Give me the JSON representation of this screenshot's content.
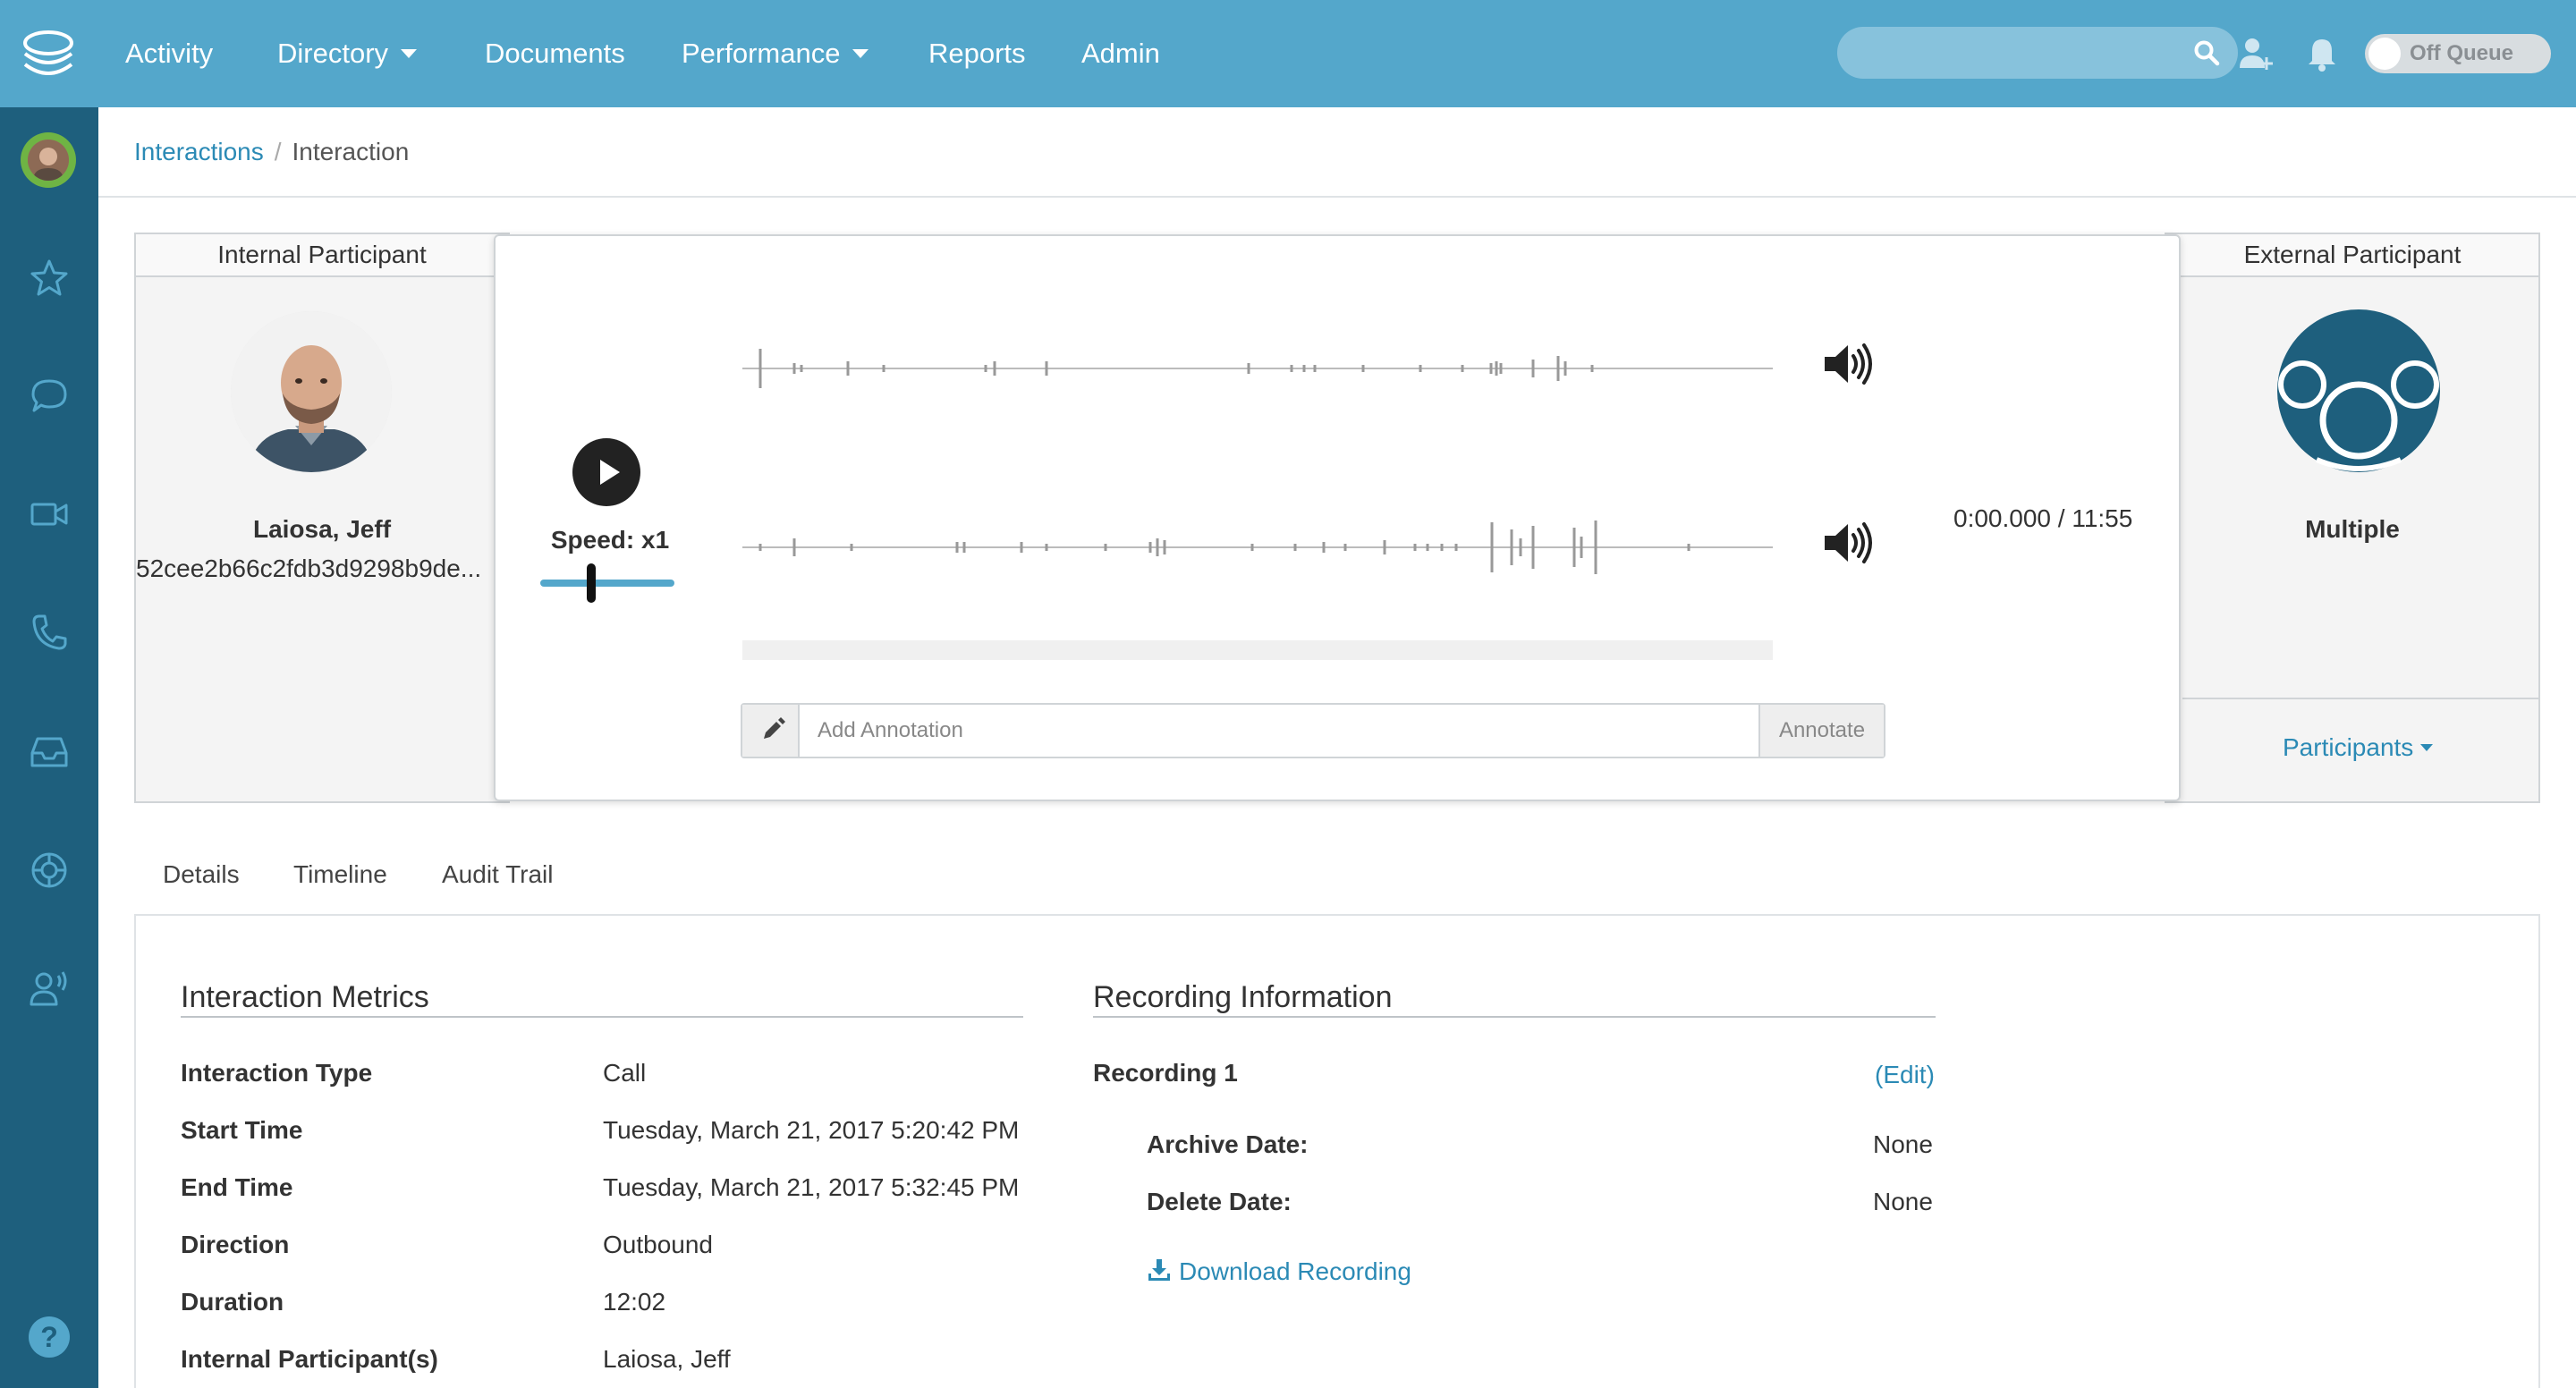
{
  "nav": {
    "items": [
      {
        "label": "Activity",
        "dropdown": false
      },
      {
        "label": "Directory",
        "dropdown": true
      },
      {
        "label": "Documents",
        "dropdown": false
      },
      {
        "label": "Performance",
        "dropdown": true
      },
      {
        "label": "Reports",
        "dropdown": false
      },
      {
        "label": "Admin",
        "dropdown": false
      }
    ],
    "search_placeholder": "",
    "queue_toggle_label": "Off Queue"
  },
  "breadcrumb": {
    "parent": "Interactions",
    "separator": "/",
    "current": "Interaction"
  },
  "internal_participant": {
    "header": "Internal Participant",
    "name": "Laiosa, Jeff",
    "id": "52cee2b66c2fdb3d9298b9de..."
  },
  "player": {
    "speed_label": "Speed: x1",
    "speed_value": 1,
    "time_display": "0:00.000 / 11:55",
    "playback_progress": 0,
    "annotation_placeholder": "Add Annotation",
    "annotate_button": "Annotate"
  },
  "external_participant": {
    "header": "External Participant",
    "name": "Multiple",
    "participants_link": "Participants"
  },
  "tabs": [
    "Details",
    "Timeline",
    "Audit Trail"
  ],
  "metrics": {
    "title": "Interaction Metrics",
    "rows": [
      {
        "label": "Interaction Type",
        "value": "Call"
      },
      {
        "label": "Start Time",
        "value": "Tuesday, March 21, 2017 5:20:42 PM"
      },
      {
        "label": "End Time",
        "value": "Tuesday, March 21, 2017 5:32:45 PM"
      },
      {
        "label": "Direction",
        "value": "Outbound"
      },
      {
        "label": "Duration",
        "value": "12:02"
      },
      {
        "label": "Internal Participant(s)",
        "value": "Laiosa, Jeff"
      }
    ]
  },
  "recording": {
    "title": "Recording Information",
    "name": "Recording 1",
    "edit_label": "(Edit)",
    "archive_label": "Archive Date:",
    "archive_value": "None",
    "delete_label": "Delete Date:",
    "delete_value": "None",
    "download_label": "Download Recording"
  },
  "colors": {
    "topbar": "#54a7cb",
    "sidebar": "#1e5f7d",
    "link": "#2b8ab5"
  },
  "icons": {
    "sidebar": [
      "star-icon",
      "chat-icon",
      "video-icon",
      "phone-icon",
      "inbox-icon",
      "lifebuoy-icon",
      "user-voice-icon"
    ],
    "top": [
      "search-icon",
      "add-user-icon",
      "bell-icon"
    ]
  }
}
